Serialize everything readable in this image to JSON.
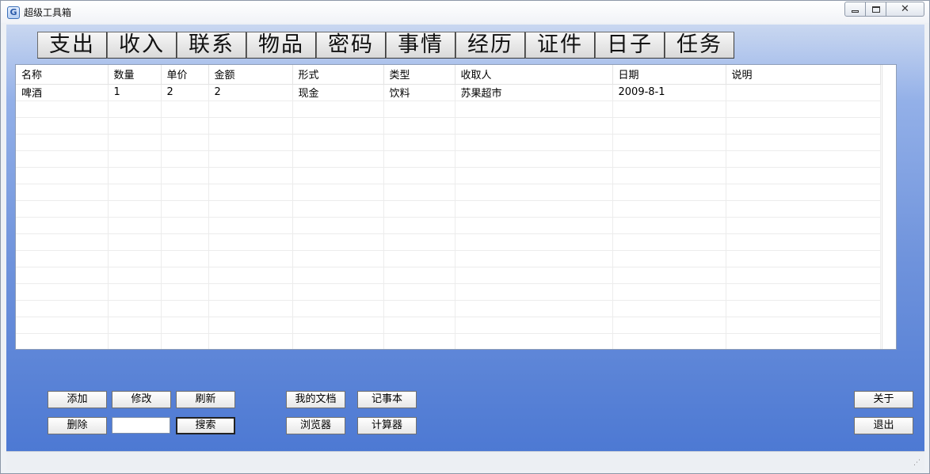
{
  "window": {
    "title": "超级工具箱",
    "icon": "app-icon"
  },
  "tabs": [
    "支出",
    "收入",
    "联系",
    "物品",
    "密码",
    "事情",
    "经历",
    "证件",
    "日子",
    "任务"
  ],
  "table": {
    "columns": [
      "名称",
      "数量",
      "单价",
      "金额",
      "形式",
      "类型",
      "收取人",
      "日期",
      "说明"
    ],
    "rows": [
      [
        "啤酒",
        "1",
        "2",
        "2",
        "现金",
        "饮料",
        "苏果超市",
        "2009-8-1",
        ""
      ]
    ]
  },
  "buttons": {
    "add": "添加",
    "edit": "修改",
    "refresh": "刷新",
    "delete": "删除",
    "search": "搜索",
    "my_docs": "我的文档",
    "notepad": "记事本",
    "browser": "浏览器",
    "calculator": "计算器",
    "about": "关于",
    "exit": "退出"
  },
  "search": {
    "value": ""
  },
  "colors": {
    "client_top": "#c9d7f0",
    "client_bottom": "#4d79d3"
  }
}
